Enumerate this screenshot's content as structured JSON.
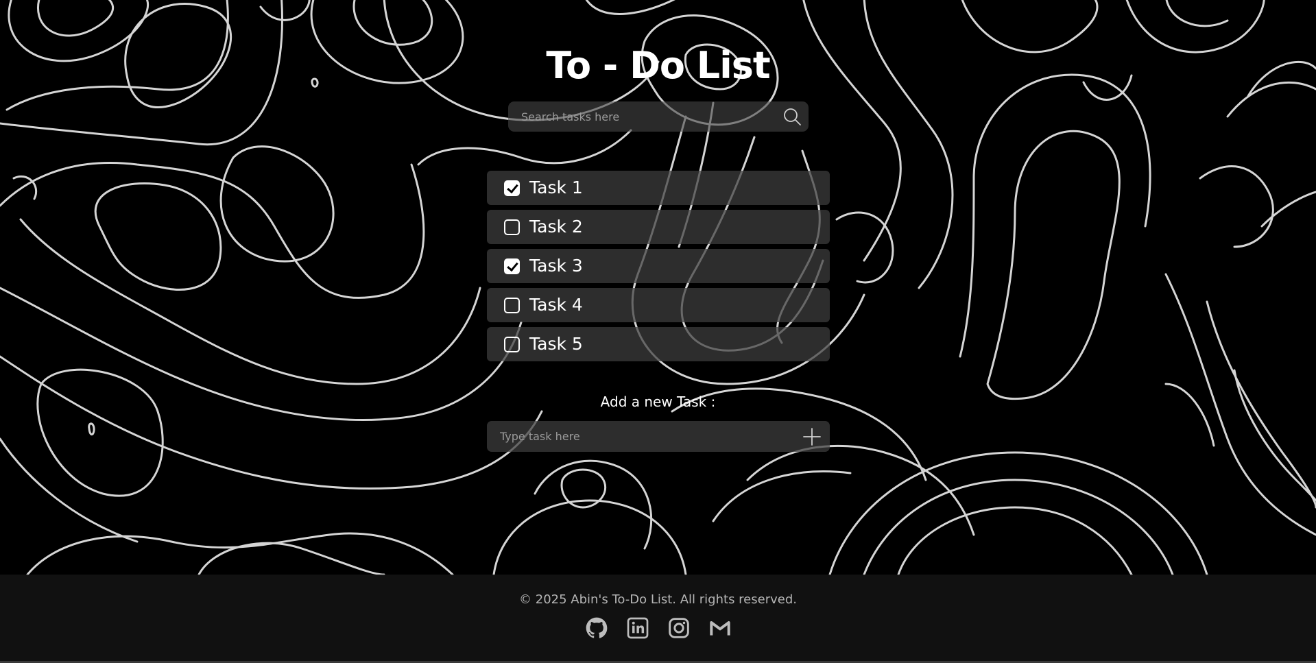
{
  "app": {
    "title": "To - Do List"
  },
  "search": {
    "placeholder": "Search tasks here",
    "value": "",
    "icon": "search-icon"
  },
  "tasks": [
    {
      "label": "Task 1",
      "checked": true
    },
    {
      "label": "Task 2",
      "checked": false
    },
    {
      "label": "Task 3",
      "checked": true
    },
    {
      "label": "Task 4",
      "checked": false
    },
    {
      "label": "Task 5",
      "checked": false
    }
  ],
  "add_task": {
    "label": "Add a new Task :",
    "placeholder": "Type task here",
    "value": "",
    "icon": "plus-icon"
  },
  "footer": {
    "copyright": "© 2025 Abin's To-Do List. All rights reserved.",
    "socials": [
      {
        "name": "github",
        "icon": "github-icon"
      },
      {
        "name": "linkedin",
        "icon": "linkedin-icon"
      },
      {
        "name": "instagram",
        "icon": "instagram-icon"
      },
      {
        "name": "gmail",
        "icon": "gmail-icon"
      }
    ]
  },
  "colors": {
    "background": "#000000",
    "contour": "#e8e8e8",
    "panel": "#3e3e3e",
    "footer": "#121212",
    "text": "#ffffff",
    "muted_text": "#b5b5b5"
  }
}
